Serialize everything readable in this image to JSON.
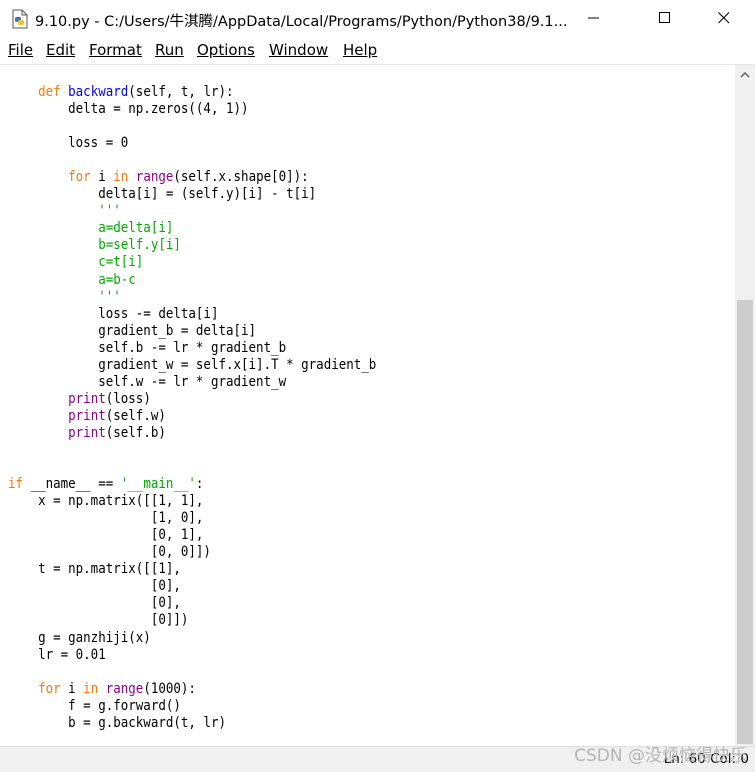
{
  "window": {
    "title": "9.10.py - C:/Users/牛淇腾/AppData/Local/Programs/Python/Python38/9.1...",
    "icon": "python-file-icon",
    "controls": {
      "minimize": "minimize-icon",
      "maximize": "maximize-icon",
      "close": "close-icon"
    }
  },
  "menu": {
    "items": [
      {
        "label": "File"
      },
      {
        "label": "Edit"
      },
      {
        "label": "Format"
      },
      {
        "label": "Run"
      },
      {
        "label": "Options"
      },
      {
        "label": "Window"
      },
      {
        "label": "Help"
      }
    ]
  },
  "editor": {
    "lines": [
      [
        {
          "t": "    "
        },
        {
          "t": "def",
          "c": "kw"
        },
        {
          "t": " "
        },
        {
          "t": "backward",
          "c": "fn"
        },
        {
          "t": "(self, t, lr):"
        }
      ],
      [
        {
          "t": "        delta = np.zeros((4, 1))"
        }
      ],
      [
        {
          "t": ""
        }
      ],
      [
        {
          "t": "        loss = 0"
        }
      ],
      [
        {
          "t": ""
        }
      ],
      [
        {
          "t": "        "
        },
        {
          "t": "for",
          "c": "kw"
        },
        {
          "t": " i "
        },
        {
          "t": "in",
          "c": "kw"
        },
        {
          "t": " "
        },
        {
          "t": "range",
          "c": "bi"
        },
        {
          "t": "(self.x.shape[0]):"
        }
      ],
      [
        {
          "t": "            delta[i] = (self.y)[i] - t[i]"
        }
      ],
      [
        {
          "t": "            "
        },
        {
          "t": "'''",
          "c": "str"
        }
      ],
      [
        {
          "t": "            "
        },
        {
          "t": "a=delta[i]",
          "c": "str"
        }
      ],
      [
        {
          "t": "            "
        },
        {
          "t": "b=self.y[i]",
          "c": "str"
        }
      ],
      [
        {
          "t": "            "
        },
        {
          "t": "c=t[i]",
          "c": "str"
        }
      ],
      [
        {
          "t": "            "
        },
        {
          "t": "a=b-c",
          "c": "str"
        }
      ],
      [
        {
          "t": "            "
        },
        {
          "t": "'''",
          "c": "str"
        }
      ],
      [
        {
          "t": "            loss -= delta[i]"
        }
      ],
      [
        {
          "t": "            gradient_b = delta[i]"
        }
      ],
      [
        {
          "t": "            self.b -= lr * gradient_b"
        }
      ],
      [
        {
          "t": "            gradient_w = self.x[i].T * gradient_b"
        }
      ],
      [
        {
          "t": "            self.w -= lr * gradient_w"
        }
      ],
      [
        {
          "t": "        "
        },
        {
          "t": "print",
          "c": "bi"
        },
        {
          "t": "(loss)"
        }
      ],
      [
        {
          "t": "        "
        },
        {
          "t": "print",
          "c": "bi"
        },
        {
          "t": "(self.w)"
        }
      ],
      [
        {
          "t": "        "
        },
        {
          "t": "print",
          "c": "bi"
        },
        {
          "t": "(self.b)"
        }
      ],
      [
        {
          "t": ""
        }
      ],
      [
        {
          "t": ""
        }
      ],
      [
        {
          "t": "if",
          "c": "kw"
        },
        {
          "t": " __name__ == "
        },
        {
          "t": "'__main__'",
          "c": "str"
        },
        {
          "t": ":"
        }
      ],
      [
        {
          "t": "    x = np.matrix([[1, 1],"
        }
      ],
      [
        {
          "t": "                   [1, 0],"
        }
      ],
      [
        {
          "t": "                   [0, 1],"
        }
      ],
      [
        {
          "t": "                   [0, 0]])"
        }
      ],
      [
        {
          "t": "    t = np.matrix([[1],"
        }
      ],
      [
        {
          "t": "                   [0],"
        }
      ],
      [
        {
          "t": "                   [0],"
        }
      ],
      [
        {
          "t": "                   [0]])"
        }
      ],
      [
        {
          "t": "    g = ganzhiji(x)"
        }
      ],
      [
        {
          "t": "    lr = 0.01"
        }
      ],
      [
        {
          "t": ""
        }
      ],
      [
        {
          "t": "    "
        },
        {
          "t": "for",
          "c": "kw"
        },
        {
          "t": " i "
        },
        {
          "t": "in",
          "c": "kw"
        },
        {
          "t": " "
        },
        {
          "t": "range",
          "c": "bi"
        },
        {
          "t": "(1000):"
        }
      ],
      [
        {
          "t": "        f = g.forward()"
        }
      ],
      [
        {
          "t": "        b = g.backward(t, lr)"
        }
      ]
    ]
  },
  "status": {
    "position": "Ln: 60  Col: 0"
  },
  "watermark": "CSDN @没烦恼得快乐",
  "colors": {
    "keyword": "#ff7700",
    "function": "#0000ff",
    "builtin": "#900090",
    "string": "#00aa00"
  }
}
